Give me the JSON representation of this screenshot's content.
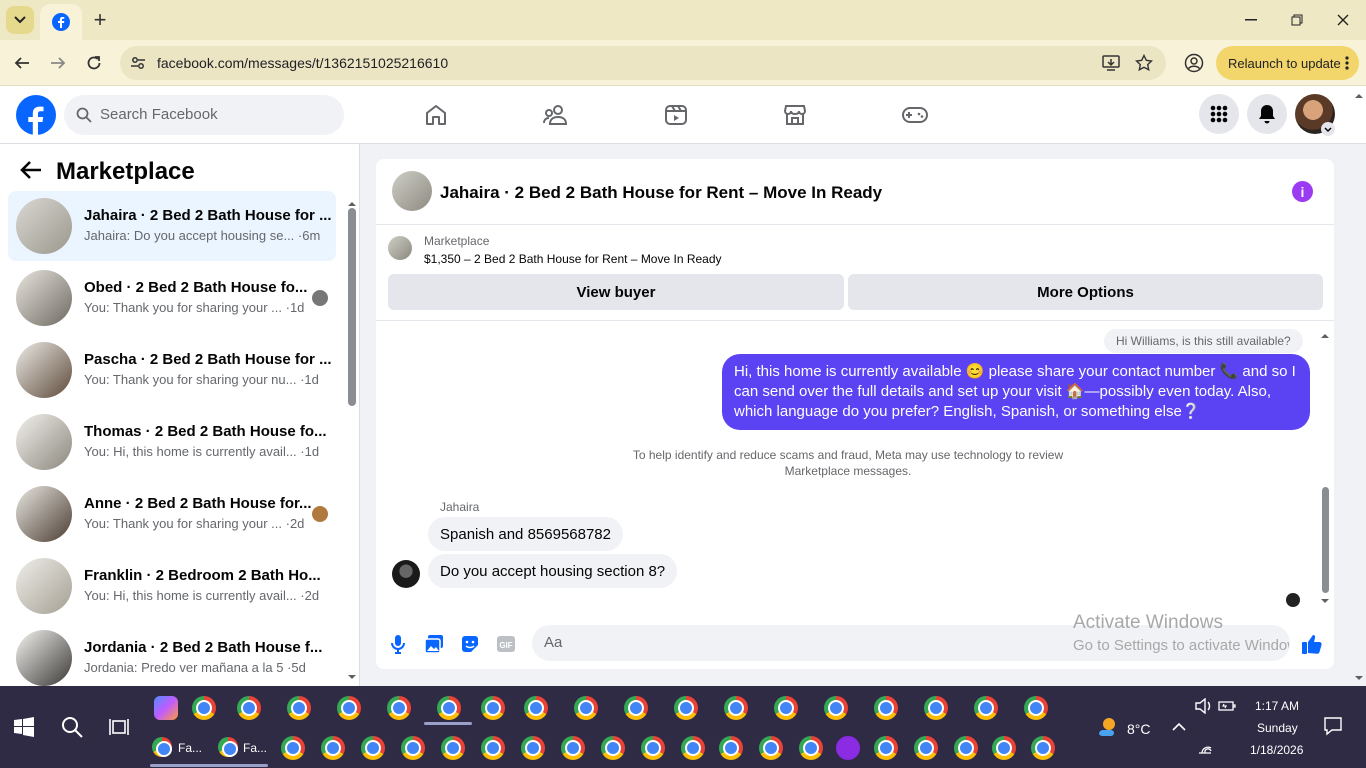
{
  "browser": {
    "url": "facebook.com/messages/t/1362151025216610",
    "relaunch_label": "Relaunch to update"
  },
  "header": {
    "search_placeholder": "Search Facebook"
  },
  "sidebar": {
    "title": "Marketplace",
    "conversations": [
      {
        "title": "Jahaira · 2 Bed 2 Bath House for ...",
        "preview": "Jahaira: Do you accept housing se... ·6m",
        "active": true
      },
      {
        "title": "Obed · 2 Bed 2 Bath House fo...",
        "preview": "You: Thank you for sharing your ... ·1d",
        "active": false
      },
      {
        "title": "Pascha · 2 Bed 2 Bath House for ...",
        "preview": "You: Thank you for sharing your nu... ·1d",
        "active": false
      },
      {
        "title": "Thomas · 2 Bed 2 Bath House fo...",
        "preview": "You: Hi, this home is currently avail... ·1d",
        "active": false
      },
      {
        "title": "Anne · 2 Bed 2 Bath House for...",
        "preview": "You: Thank you for sharing your ... ·2d",
        "active": false
      },
      {
        "title": "Franklin · 2 Bedroom 2 Bath Ho...",
        "preview": "You: Hi, this home is currently avail... ·2d",
        "active": false
      },
      {
        "title": "Jordania · 2 Bed 2 Bath House f...",
        "preview": "Jordania: Predo ver mañana a la 5 ·5d",
        "active": false
      }
    ]
  },
  "chat": {
    "title": "Jahaira · 2 Bed 2 Bath House for Rent – Move In Ready",
    "marketplace_label": "Marketplace",
    "listing": "$1,350 – 2 Bed 2 Bath House for Rent – Move In Ready",
    "view_buyer": "View buyer",
    "more_options": "More Options",
    "reply_preview": "Hi Williams, is this still available?",
    "outgoing": "Hi, this home is currently available 😊 please share your contact number 📞 and  so I can send over the full details and set up your visit 🏠—possibly even today. Also, which language do you prefer? English, Spanish, or something else❔",
    "notice": "To help identify and reduce scams and fraud, Meta may use technology to review Marketplace messages.",
    "sender_name": "Jahaira",
    "incoming": [
      "Spanish and 8569568782",
      "Do you accept housing section 8?"
    ],
    "composer_placeholder": "Aa"
  },
  "watermark": {
    "line1": "Activate Windows",
    "line2": "Go to Settings to activate Windows."
  },
  "taskbar": {
    "weather": "8°C",
    "time": "1:17 AM",
    "day": "Sunday",
    "date": "1/18/2026",
    "pinned_labels": [
      "Fa...",
      "Fa..."
    ]
  },
  "colors": {
    "fb_blue": "#0866ff",
    "outgoing_bubble": "#5b42f3",
    "info_purple": "#9b3cf2"
  }
}
